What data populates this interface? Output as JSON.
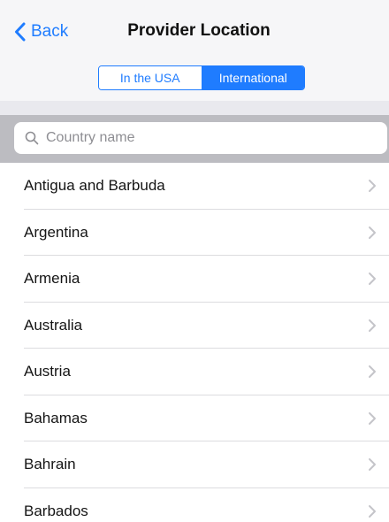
{
  "nav": {
    "back_label": "Back",
    "title": "Provider Location"
  },
  "segmented": {
    "options": [
      "In the USA",
      "International"
    ],
    "selected": "International"
  },
  "search": {
    "placeholder": "Country name",
    "value": ""
  },
  "countries": [
    "Antigua and Barbuda",
    "Argentina",
    "Armenia",
    "Australia",
    "Austria",
    "Bahamas",
    "Bahrain",
    "Barbados"
  ],
  "colors": {
    "accent": "#1f7cff",
    "nav_background": "#f6f6f8",
    "separator": "#bcbcc1",
    "chevron": "#c4c4c9",
    "placeholder": "#8e8e93"
  },
  "icons": {
    "back": "chevron-left-icon",
    "search": "search-icon",
    "row_disclosure": "chevron-right-icon"
  }
}
